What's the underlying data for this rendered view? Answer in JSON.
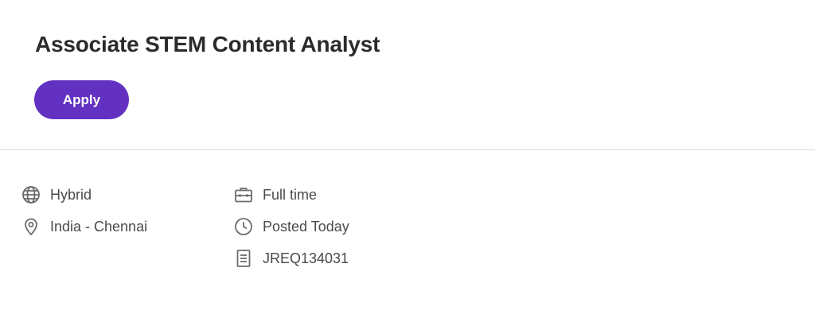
{
  "job": {
    "title": "Associate STEM Content Analyst",
    "apply_label": "Apply"
  },
  "details": {
    "work_mode": {
      "label": "Hybrid",
      "icon": "globe-icon"
    },
    "location": {
      "label": "India - Chennai",
      "icon": "location-pin-icon"
    },
    "employment_type": {
      "label": "Full time",
      "icon": "briefcase-icon"
    },
    "posted": {
      "label": "Posted Today",
      "icon": "clock-icon"
    },
    "requisition": {
      "label": "JREQ134031",
      "icon": "document-icon"
    }
  },
  "colors": {
    "accent": "#6231c2",
    "divider": "#d9d9d9",
    "icon": "#6b6b6b"
  }
}
